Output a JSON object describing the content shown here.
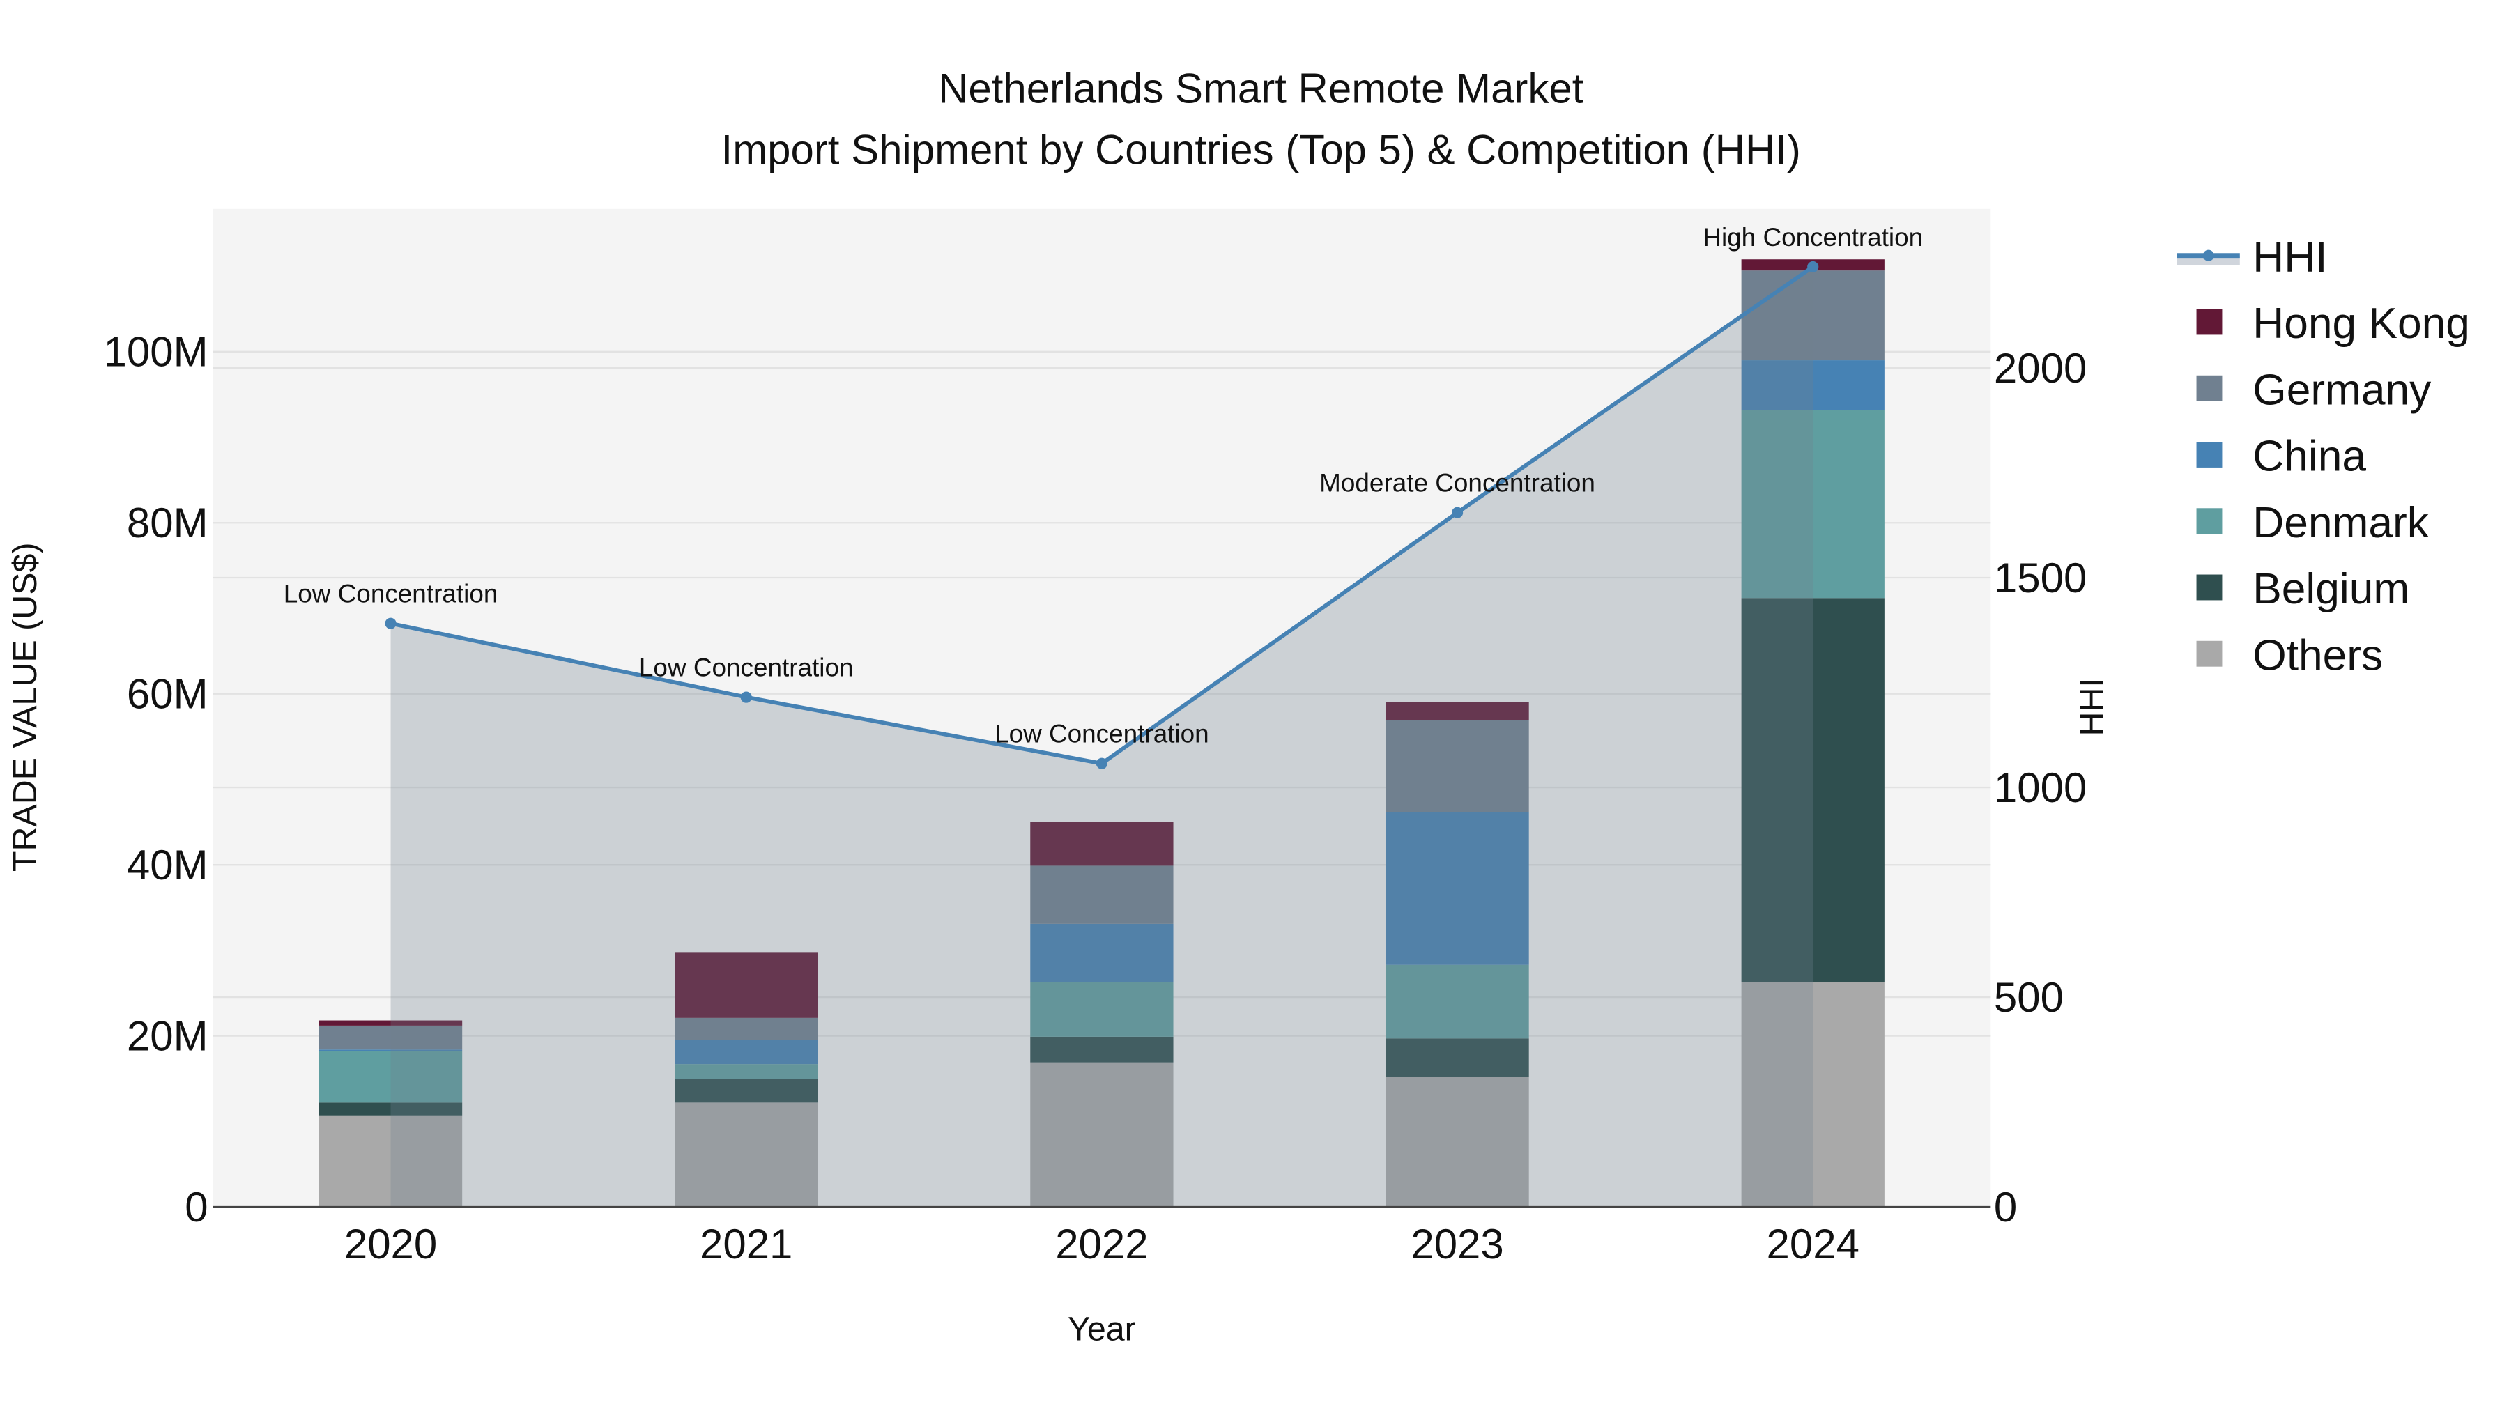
{
  "chart_data": {
    "type": "bar",
    "title_line1": "Netherlands Smart Remote Market",
    "title_line2": "Import Shipment by Countries (Top 5) & Competition (HHI)",
    "xlabel": "Year",
    "ylabel": "TRADE VALUE (US$)",
    "y2label": "HHI",
    "categories": [
      "2020",
      "2021",
      "2022",
      "2023",
      "2024"
    ],
    "ylim": [
      0,
      116700000
    ],
    "y2lim": [
      0,
      2379
    ],
    "yticks": [
      {
        "value": 0,
        "label": "0"
      },
      {
        "value": 20000000,
        "label": "20M"
      },
      {
        "value": 40000000,
        "label": "40M"
      },
      {
        "value": 60000000,
        "label": "60M"
      },
      {
        "value": 80000000,
        "label": "80M"
      },
      {
        "value": 100000000,
        "label": "100M"
      }
    ],
    "y2ticks": [
      {
        "value": 0,
        "label": "0"
      },
      {
        "value": 500,
        "label": "500"
      },
      {
        "value": 1000,
        "label": "1000"
      },
      {
        "value": 1500,
        "label": "1500"
      },
      {
        "value": 2000,
        "label": "2000"
      }
    ],
    "series": [
      {
        "name": "Others",
        "color": "#A9A9A9",
        "values": [
          10700000,
          12200000,
          16900000,
          15200000,
          26300000
        ]
      },
      {
        "name": "Belgium",
        "color": "#2F4F4F",
        "values": [
          1500000,
          2800000,
          3000000,
          4500000,
          44900000
        ]
      },
      {
        "name": "Denmark",
        "color": "#5F9EA0",
        "values": [
          6000000,
          1700000,
          6400000,
          8600000,
          22000000
        ]
      },
      {
        "name": "China",
        "color": "#4682B4",
        "values": [
          200000,
          2800000,
          6800000,
          17900000,
          5800000
        ]
      },
      {
        "name": "Germany",
        "color": "#708090",
        "values": [
          2800000,
          2600000,
          6800000,
          10700000,
          10500000
        ]
      },
      {
        "name": "Hong Kong",
        "color": "#621836",
        "values": [
          600000,
          7700000,
          5100000,
          2100000,
          1300000
        ]
      }
    ],
    "hhi": {
      "name": "HHI",
      "color": "#4682B4",
      "values": [
        1391,
        1215,
        1057,
        1655,
        2241
      ],
      "annotations": [
        "Low Concentration",
        "Low Concentration",
        "Low Concentration",
        "Moderate Concentration",
        "High Concentration"
      ]
    },
    "legend_order": [
      "HHI",
      "Hong Kong",
      "Germany",
      "China",
      "Denmark",
      "Belgium",
      "Others"
    ],
    "legend_placement": "right",
    "grid": true
  }
}
